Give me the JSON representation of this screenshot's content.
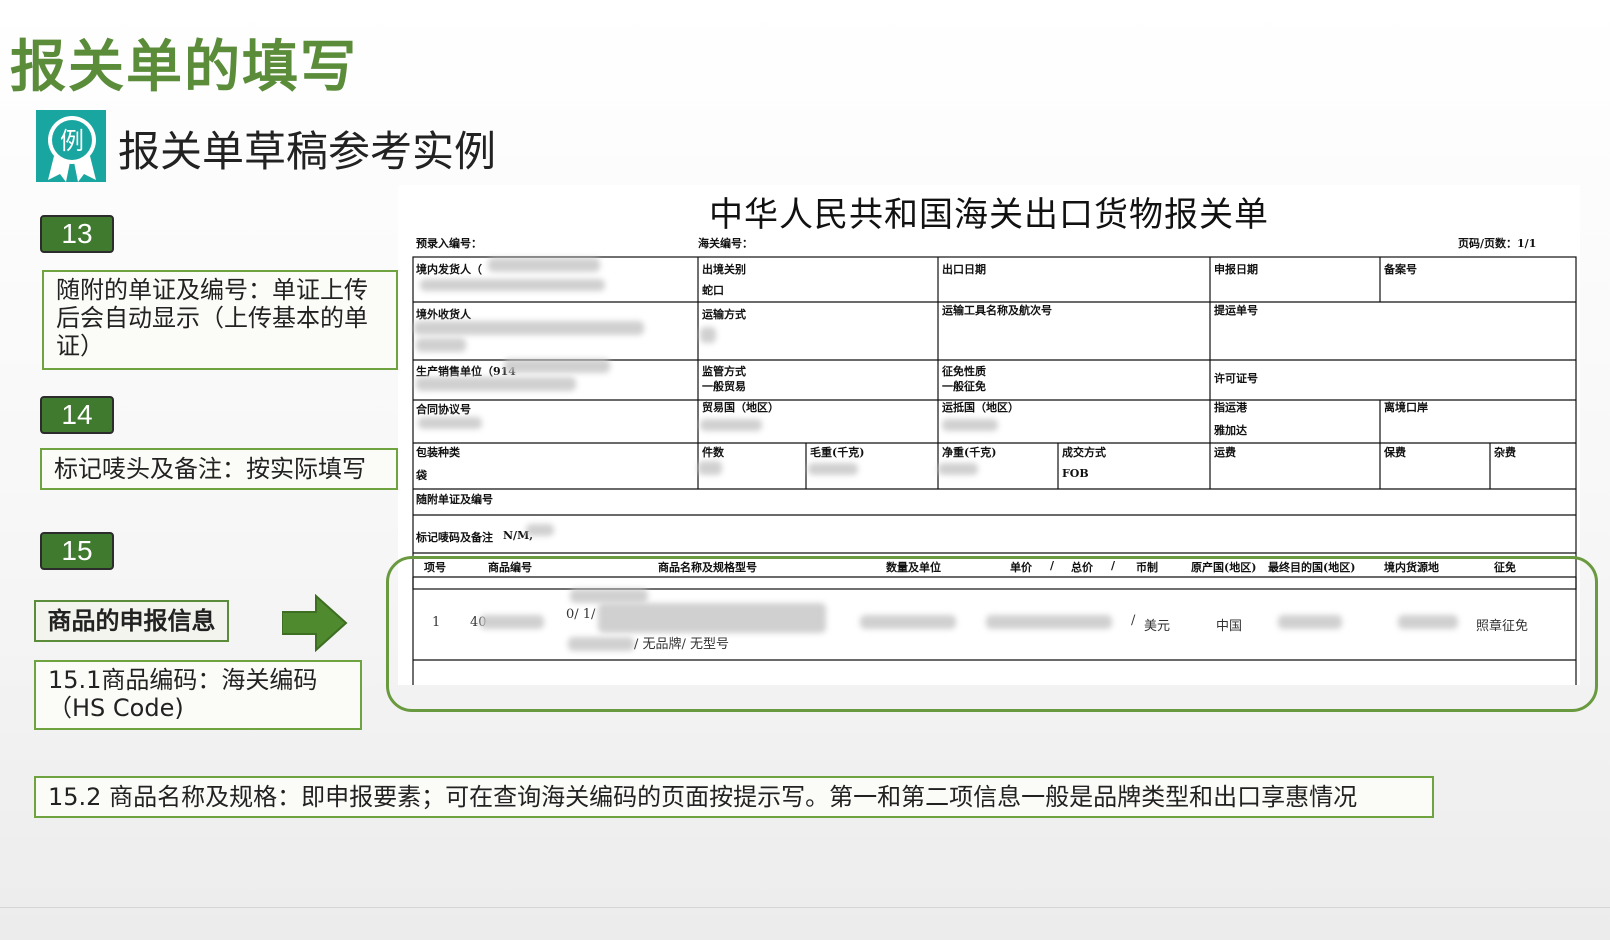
{
  "title": "报关单的填写",
  "subtitle": "报关单草稿参考实例",
  "icon_char": "例",
  "notes": [
    {
      "num": "13",
      "text": "随附的单证及编号：单证上传后会自动显示（上传基本的单证）"
    },
    {
      "num": "14",
      "text": "标记唛头及备注：按实际填写"
    },
    {
      "num": "15",
      "text": "商品的申报信息"
    }
  ],
  "note_15_1": "15.1商品编码：海关编码（HS Code)",
  "note_15_2": "15.2 商品名称及规格：即申报要素；可在查询海关编码的页面按提示写。第一和第二项信息一般是品牌类型和出口享惠情况",
  "form": {
    "title": "中华人民共和国海关出口货物报关单",
    "pre_entry_no": "预录入编号：",
    "customs_no": "海关编号：",
    "page": "页码/页数：1/1",
    "domestic_consignor": "境内发货人（",
    "exit_customs": "出境关别",
    "exit_customs_value": "蛇口",
    "export_date": "出口日期",
    "declare_date": "申报日期",
    "filing_no": "备案号",
    "overseas_consignee": "境外收货人",
    "transport_mode": "运输方式",
    "transport_name": "运输工具名称及航次号",
    "bill_no": "提运单号",
    "producer": "生产销售单位（914",
    "supervision_mode": "监管方式",
    "supervision_value": "一般贸易",
    "exemption": "征免性质",
    "exemption_value": "一般征免",
    "license_no": "许可证号",
    "contract_no": "合同协议号",
    "trade_country": "贸易国（地区）",
    "destination_country": "运抵国（地区）",
    "port": "指运港",
    "port_value": "雅加达",
    "exit_port": "离境口岸",
    "package_type": "包装种类",
    "package_value": "袋",
    "pieces": "件数",
    "gross_weight": "毛重(千克)",
    "net_weight": "净重(千克)",
    "transaction_mode": "成交方式",
    "transaction_value": "FOB",
    "freight": "运费",
    "insurance": "保费",
    "misc": "杂费",
    "attached_docs": "随附单证及编号",
    "marks": "标记唛码及备注",
    "marks_value": "N/M,",
    "goods_headers": [
      "项号",
      "商品编号",
      "商品名称及规格型号",
      "数量及单位",
      "单价",
      "/",
      "总价",
      "/",
      "币制",
      "原产国(地区)",
      "最终目的国(地区)",
      "境内货源地",
      "征免"
    ],
    "goods_row": {
      "item": "1",
      "code": "40",
      "spec_line1": "0/ 1/",
      "spec_line3": "/ 无品牌/ 无型号",
      "currency_sep": "/",
      "currency": "美元",
      "origin": "中国",
      "exemption": "照章征免"
    }
  }
}
